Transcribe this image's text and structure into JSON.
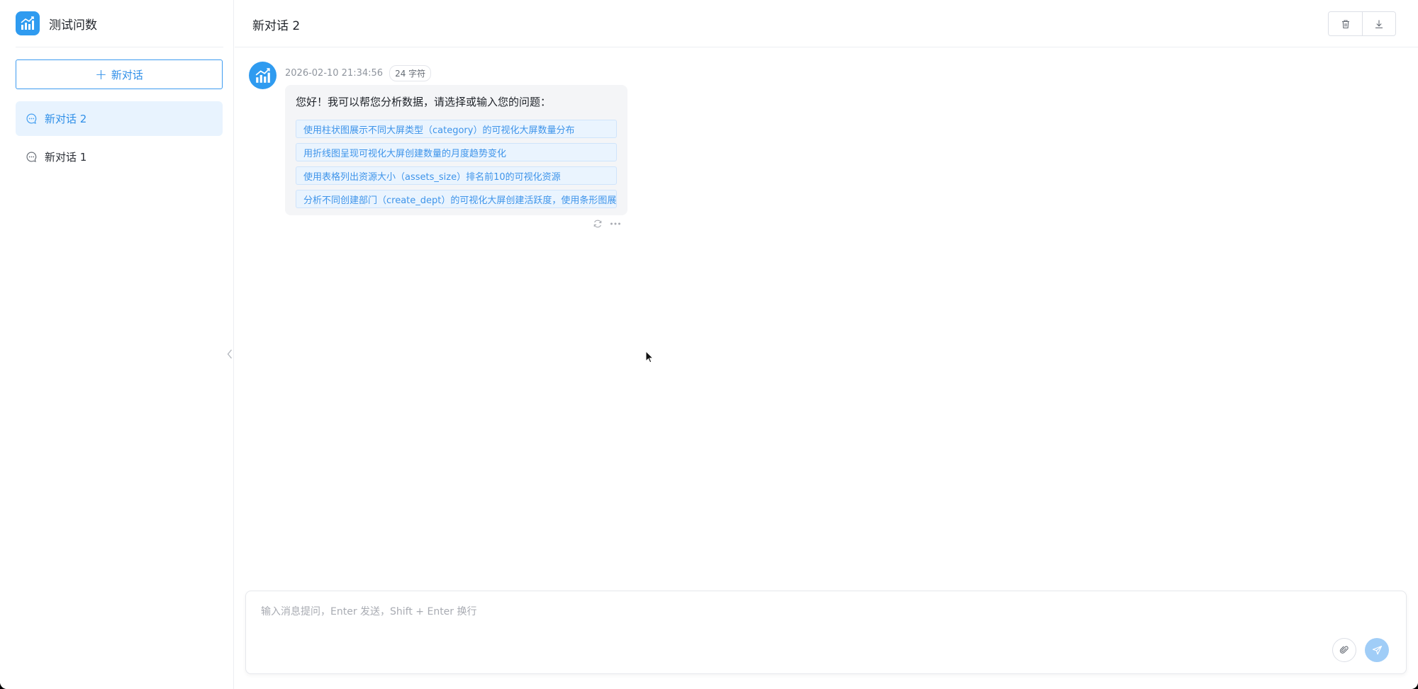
{
  "brand": {
    "title": "测试问数"
  },
  "sidebar": {
    "new_chat_label": "新对话",
    "conversations": [
      {
        "label": "新对话 2",
        "active": true
      },
      {
        "label": "新对话 1",
        "active": false
      }
    ]
  },
  "header": {
    "title": "新对话 2"
  },
  "message": {
    "timestamp": "2026-02-10 21:34:56",
    "char_count": "24 字符",
    "text": "您好！我可以帮您分析数据，请选择或输入您的问题：",
    "suggestions": [
      "使用柱状图展示不同大屏类型（category）的可视化大屏数量分布",
      "用折线图呈现可视化大屏创建数量的月度趋势变化",
      "使用表格列出资源大小（assets_size）排名前10的可视化资源",
      "分析不同创建部门（create_dept）的可视化大屏创建活跃度，使用条形图展示"
    ]
  },
  "input": {
    "placeholder": "输入消息提问，Enter 发送，Shift + Enter 换行"
  },
  "colors": {
    "accent": "#2f9bf0",
    "active_bg": "#e8f3fe",
    "send_disabled": "#a0cdf7"
  }
}
